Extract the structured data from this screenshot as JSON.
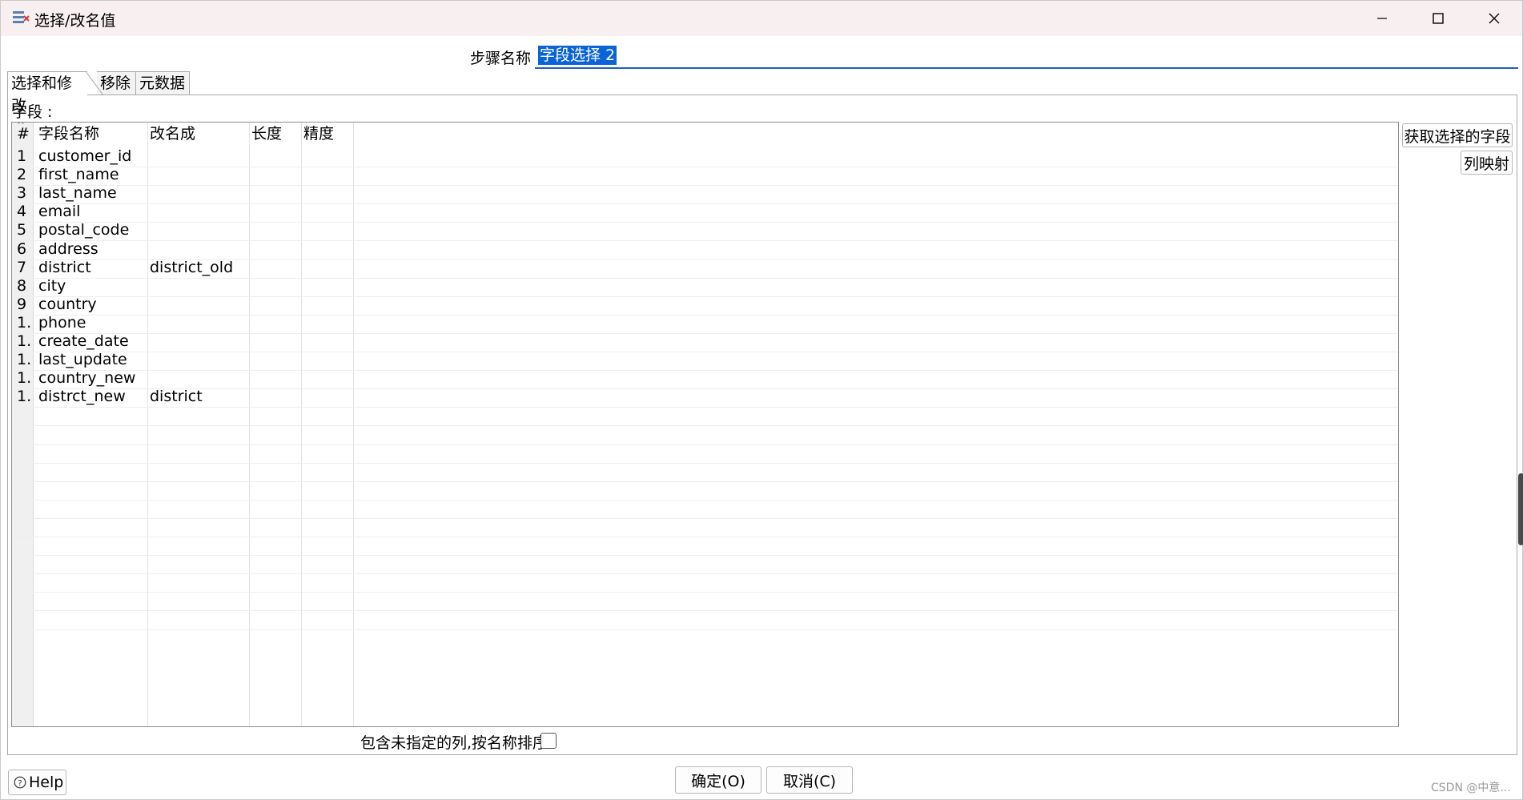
{
  "window": {
    "title": "选择/改名值"
  },
  "step": {
    "label": "步骤名称",
    "value": "字段选择 2"
  },
  "tabs": [
    {
      "label": "选择和修改",
      "active": true
    },
    {
      "label": "移除",
      "active": false
    },
    {
      "label": "元数据",
      "active": false
    }
  ],
  "fields": {
    "label": "字段 :",
    "columns": [
      "#",
      "字段名称",
      "改名成",
      "长度",
      "精度"
    ],
    "rows": [
      {
        "num": "1",
        "name": "customer_id",
        "rename": "",
        "length": "",
        "precision": ""
      },
      {
        "num": "2",
        "name": "first_name",
        "rename": "",
        "length": "",
        "precision": ""
      },
      {
        "num": "3",
        "name": "last_name",
        "rename": "",
        "length": "",
        "precision": ""
      },
      {
        "num": "4",
        "name": "email",
        "rename": "",
        "length": "",
        "precision": ""
      },
      {
        "num": "5",
        "name": "postal_code",
        "rename": "",
        "length": "",
        "precision": ""
      },
      {
        "num": "6",
        "name": "address",
        "rename": "",
        "length": "",
        "precision": ""
      },
      {
        "num": "7",
        "name": "district",
        "rename": "district_old",
        "length": "",
        "precision": ""
      },
      {
        "num": "8",
        "name": "city",
        "rename": "",
        "length": "",
        "precision": ""
      },
      {
        "num": "9",
        "name": "country",
        "rename": "",
        "length": "",
        "precision": ""
      },
      {
        "num": "1.",
        "name": "phone",
        "rename": "",
        "length": "",
        "precision": ""
      },
      {
        "num": "1.",
        "name": "create_date",
        "rename": "",
        "length": "",
        "precision": ""
      },
      {
        "num": "1.",
        "name": "last_update",
        "rename": "",
        "length": "",
        "precision": ""
      },
      {
        "num": "1.",
        "name": "country_new",
        "rename": "",
        "length": "",
        "precision": ""
      },
      {
        "num": "1.",
        "name": "distrct_new",
        "rename": "district",
        "length": "",
        "precision": ""
      }
    ]
  },
  "buttons": {
    "get_fields": "获取选择的字段",
    "column_mapping": "列映射",
    "help": "Help",
    "ok": "确定(O)",
    "cancel": "取消(C)"
  },
  "include_unspecified": {
    "label": "包含未指定的列,按名称排序",
    "checked": false
  },
  "watermark": "CSDN @中意..."
}
